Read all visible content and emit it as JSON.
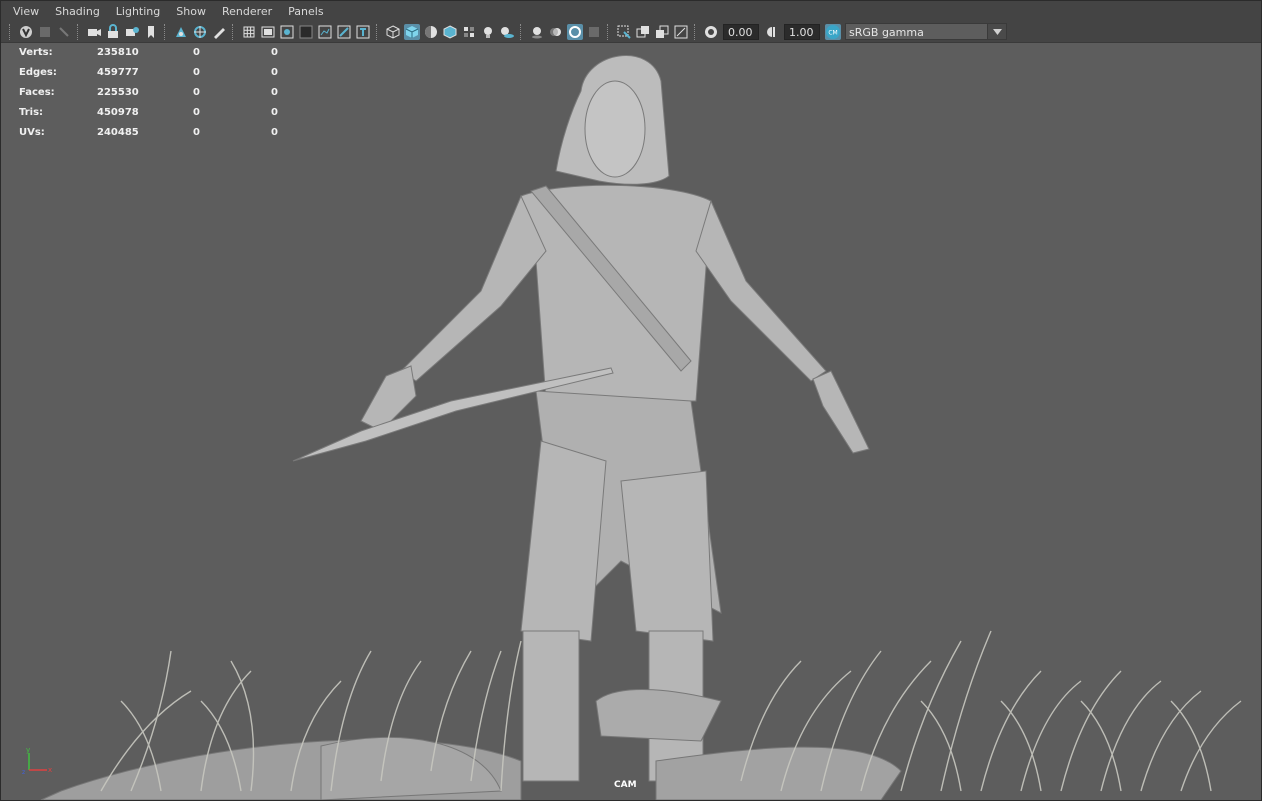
{
  "menu": [
    "View",
    "Shading",
    "Lighting",
    "Show",
    "Renderer",
    "Panels"
  ],
  "toolbar": {
    "exposure_value": "0.00",
    "gamma_value": "1.00",
    "color_space": "sRGB gamma"
  },
  "hud": {
    "rows": [
      {
        "label": "Verts:",
        "total": "235810",
        "selected": "0",
        "components": "0"
      },
      {
        "label": "Edges:",
        "total": "459777",
        "selected": "0",
        "components": "0"
      },
      {
        "label": "Faces:",
        "total": "225530",
        "selected": "0",
        "components": "0"
      },
      {
        "label": "Tris:",
        "total": "450978",
        "selected": "0",
        "components": "0"
      },
      {
        "label": "UVs:",
        "total": "240485",
        "selected": "0",
        "components": "0"
      }
    ]
  },
  "camera_label": "CAM",
  "axis": {
    "y": "y",
    "x": "x",
    "z": "z"
  },
  "colors": {
    "viewport_bg": "#5d5d5d",
    "ui_bg": "#444444",
    "accent": "#5ab4d0",
    "axis_x": "#e04040",
    "axis_y": "#40c040",
    "model_gray": "#b8b8b8"
  }
}
